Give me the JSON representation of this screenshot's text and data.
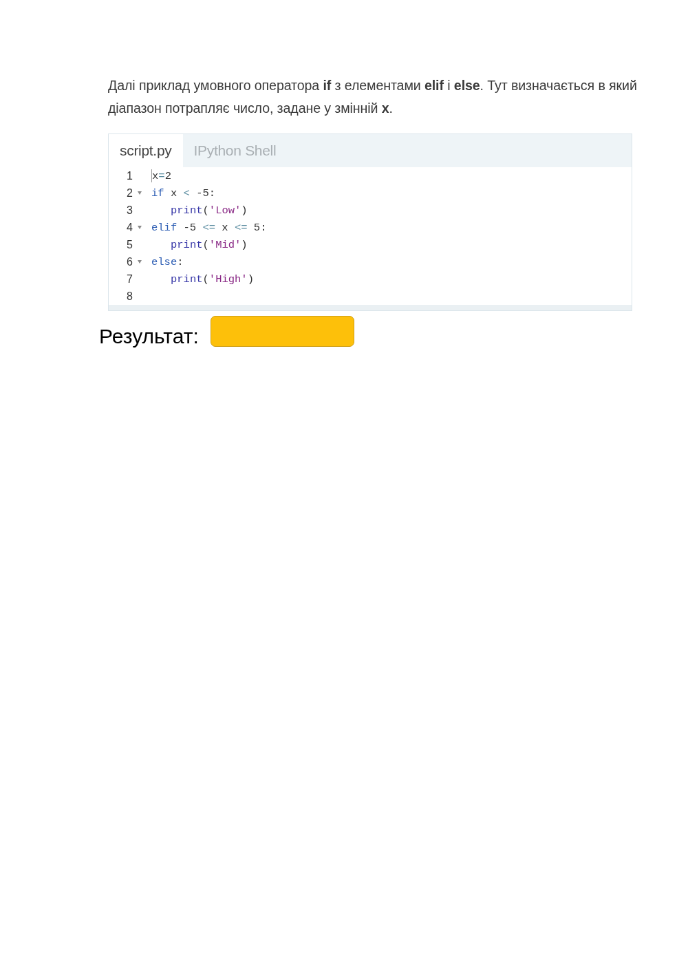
{
  "intro": "Далі приклад умовного оператора **if** з елементами **elif** і **else**. Тут визначається в який діапазон потрапляє число, задане у змінній **x**.",
  "editor": {
    "tabs": [
      {
        "label": "script.py",
        "selected": true
      },
      {
        "label": "IPython Shell",
        "selected": false
      }
    ],
    "lines": [
      {
        "number": "1",
        "active": true,
        "tokens": [
          {
            "text": "x",
            "kind": "plain"
          },
          {
            "text": "=",
            "kind": "operator"
          },
          {
            "text": "2",
            "kind": "plain"
          }
        ]
      },
      {
        "number": "2",
        "active": false,
        "tokens": [
          {
            "text": "if",
            "kind": "keyword"
          },
          {
            "text": " x ",
            "kind": "plain"
          },
          {
            "text": "<",
            "kind": "operator"
          },
          {
            "text": " -5:",
            "kind": "plain"
          }
        ],
        "children": [
          {
            "number": "3",
            "active": false,
            "tokens": [
              {
                "text": "print",
                "kind": "builtin"
              },
              {
                "text": "(",
                "kind": "plain"
              },
              {
                "text": "'Low'",
                "kind": "string"
              },
              {
                "text": ")",
                "kind": "plain"
              }
            ]
          }
        ]
      },
      {
        "number": "4",
        "active": false,
        "tokens": [
          {
            "text": "elif",
            "kind": "keyword"
          },
          {
            "text": " -5 ",
            "kind": "plain"
          },
          {
            "text": "<=",
            "kind": "operator"
          },
          {
            "text": " x ",
            "kind": "plain"
          },
          {
            "text": "<=",
            "kind": "operator"
          },
          {
            "text": " 5:",
            "kind": "plain"
          }
        ],
        "children": [
          {
            "number": "5",
            "active": false,
            "tokens": [
              {
                "text": "print",
                "kind": "builtin"
              },
              {
                "text": "(",
                "kind": "plain"
              },
              {
                "text": "'Mid'",
                "kind": "string"
              },
              {
                "text": ")",
                "kind": "plain"
              }
            ]
          }
        ]
      },
      {
        "number": "6",
        "active": false,
        "tokens": [
          {
            "text": "else",
            "kind": "keyword"
          },
          {
            "text": ":",
            "kind": "plain"
          }
        ],
        "children": [
          {
            "number": "7",
            "active": false,
            "tokens": [
              {
                "text": "print",
                "kind": "builtin"
              },
              {
                "text": "(",
                "kind": "plain"
              },
              {
                "text": "'High'",
                "kind": "string"
              },
              {
                "text": ")",
                "kind": "plain"
              }
            ]
          }
        ]
      },
      {
        "number": "8",
        "active": false
      }
    ]
  },
  "result": {
    "label": "Результат:"
  }
}
